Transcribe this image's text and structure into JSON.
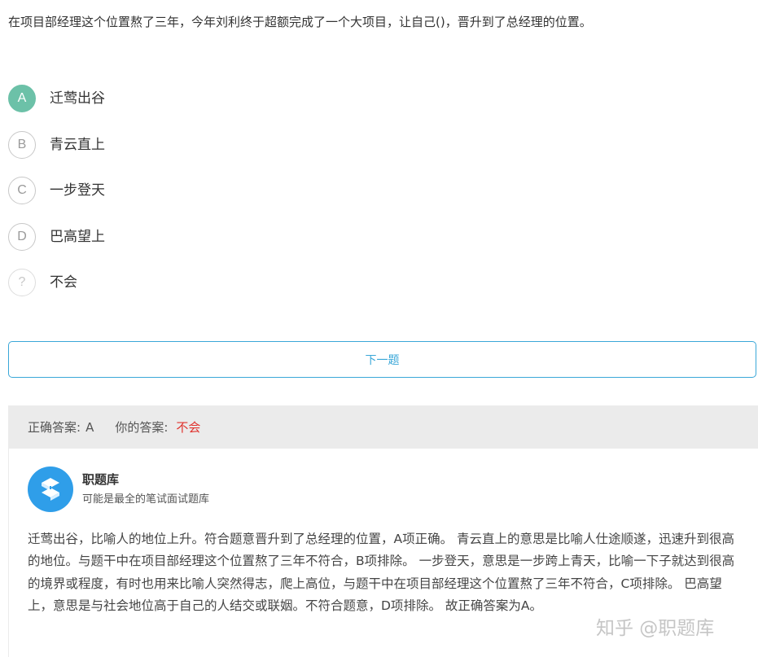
{
  "question": {
    "text": "在项目部经理这个位置熬了三年，今年刘利终于超额完成了一个大项目，让自己()，晋升到了总经理的位置。"
  },
  "options": [
    {
      "letter": "A",
      "text": "迁莺出谷",
      "selected": true
    },
    {
      "letter": "B",
      "text": "青云直上",
      "selected": false
    },
    {
      "letter": "C",
      "text": "一步登天",
      "selected": false
    },
    {
      "letter": "D",
      "text": "巴高望上",
      "selected": false
    },
    {
      "letter": "?",
      "text": "不会",
      "selected": false
    }
  ],
  "next_button": {
    "label": "下一题"
  },
  "answer": {
    "correct_label": "正确答案:",
    "correct_value": "A",
    "yours_label": "你的答案:",
    "yours_value": "不会"
  },
  "explanation": {
    "author_name": "职题库",
    "author_desc": "可能是最全的笔试面试题库",
    "text": "迁莺出谷，比喻人的地位上升。符合题意晋升到了总经理的位置，A项正确。 青云直上的意思是比喻人仕途顺遂，迅速升到很高的地位。与题干中在项目部经理这个位置熬了三年不符合，B项排除。 一步登天，意思是一步跨上青天，比喻一下子就达到很高的境界或程度，有时也用来比喻人突然得志，爬上高位，与题干中在项目部经理这个位置熬了三年不符合，C项排除。 巴高望上，意思是与社会地位高于自己的人结交或联姻。不符合题意，D项排除。 故正确答案为A。"
  },
  "watermark": "知乎 @职题库",
  "colors": {
    "selected": "#6cc1a8",
    "accent": "#3aa7d8",
    "wrong": "#e0342f",
    "logo": "#2f9ee9"
  }
}
